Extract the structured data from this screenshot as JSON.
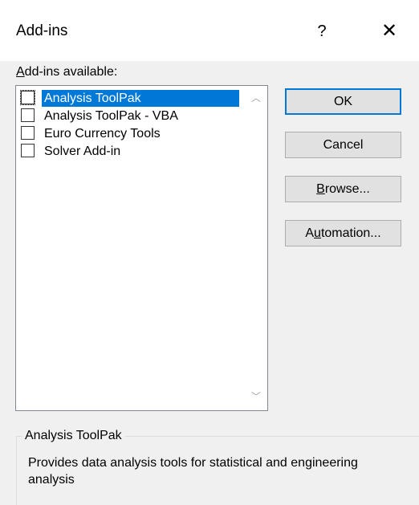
{
  "dialog": {
    "title": "Add-ins",
    "help_label": "?",
    "close_label": "✕"
  },
  "list": {
    "label_accel": "A",
    "label_rest": "dd-ins available:",
    "items": [
      {
        "label": "Analysis ToolPak",
        "checked": false,
        "selected": true
      },
      {
        "label": "Analysis ToolPak - VBA",
        "checked": false,
        "selected": false
      },
      {
        "label": "Euro Currency Tools",
        "checked": false,
        "selected": false
      },
      {
        "label": "Solver Add-in",
        "checked": false,
        "selected": false
      }
    ],
    "scroll_up_glyph": "︿",
    "scroll_down_glyph": "﹀"
  },
  "buttons": {
    "ok": "OK",
    "cancel": "Cancel",
    "browse_accel": "B",
    "browse_rest": "rowse...",
    "automation_pre": "A",
    "automation_accel": "u",
    "automation_rest": "tomation..."
  },
  "description": {
    "title": "Analysis ToolPak",
    "text": "Provides data analysis tools for statistical and engineering analysis"
  },
  "colors": {
    "selection": "#0078d7",
    "dialog_background": "#f0f0f0",
    "default_button_border": "#0078d7"
  },
  "icons": {
    "help": "question-icon",
    "close": "close-icon",
    "scroll_up": "chevron-up-icon",
    "scroll_down": "chevron-down-icon"
  }
}
